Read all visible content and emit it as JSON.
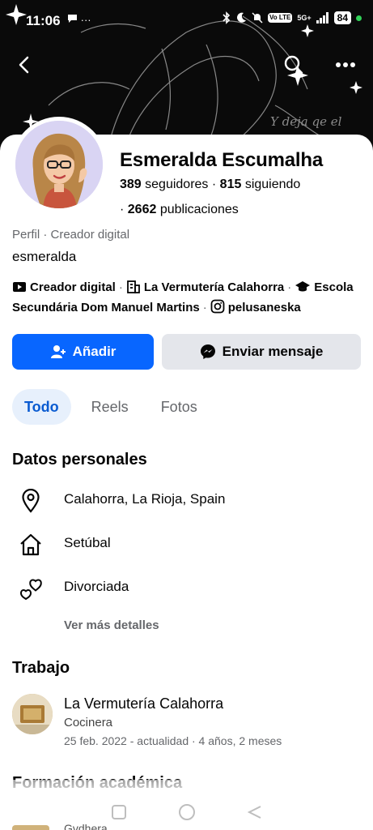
{
  "status_bar": {
    "time": "11:06",
    "left_extra": "···",
    "battery": "84",
    "network": "5G+",
    "volte": "Vo LTE"
  },
  "cover": {
    "script_text": "Y deja qe el"
  },
  "profile": {
    "name": "Esmeralda Escumalha",
    "followers_count": "389",
    "followers_label": "seguidores",
    "following_count": "815",
    "following_label": "siguiendo",
    "posts_count": "2662",
    "posts_label": "publicaciones",
    "type_line": "Perfil · Creador digital",
    "username": "esmeralda"
  },
  "links": {
    "creator": "Creador digital",
    "workplace": "La Vermutería Calahorra",
    "school": "Escola Secundária Dom Manuel Martins",
    "instagram": "pelusaneska"
  },
  "actions": {
    "add_label": "Añadir",
    "message_label": "Enviar mensaje"
  },
  "tabs": [
    {
      "label": "Todo",
      "active": true
    },
    {
      "label": "Reels",
      "active": false
    },
    {
      "label": "Fotos",
      "active": false
    }
  ],
  "personal": {
    "title": "Datos personales",
    "location": "Calahorra, La Rioja, Spain",
    "hometown": "Setúbal",
    "relationship": "Divorciada",
    "more_label": "Ver más detalles"
  },
  "work": {
    "title": "Trabajo",
    "company": "La Vermutería Calahorra",
    "role": "Cocinera",
    "dates": "25 feb. 2022 - actualidad · 4 años, 2 meses"
  },
  "education": {
    "title": "Formación académica",
    "peek": "Gvdhera"
  },
  "colors": {
    "primary": "#0866ff",
    "secondary_button": "#e4e6eb",
    "tab_active_bg": "#e7f0fc",
    "tab_active_text": "#0a5bd1",
    "muted_text": "#65676b"
  }
}
